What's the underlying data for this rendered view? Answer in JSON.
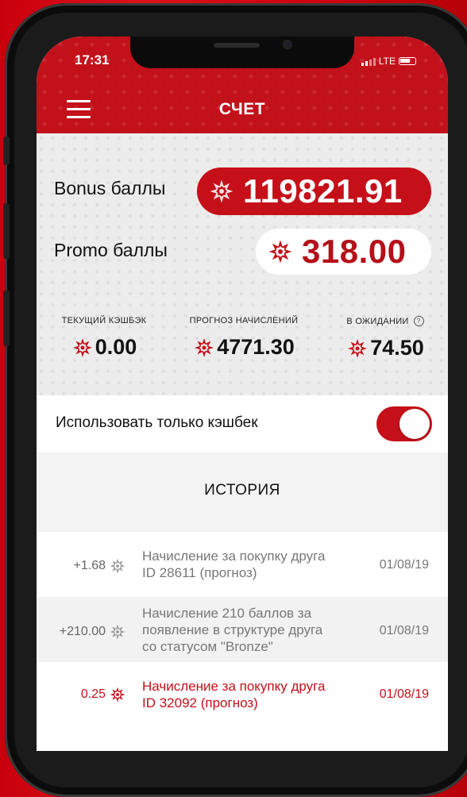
{
  "status": {
    "time": "17:31",
    "network": "LTE"
  },
  "header": {
    "title": "СЧЕТ"
  },
  "balances": {
    "bonus_label": "Bonus баллы",
    "bonus_value": "119821.91",
    "promo_label": "Promo баллы",
    "promo_value": "318.00"
  },
  "stats": [
    {
      "label": "ТЕКУЩИЙ КЭШБЭК",
      "value": "0.00"
    },
    {
      "label": "ПРОГНОЗ НАЧИСЛЕНИЙ",
      "value": "4771.30"
    },
    {
      "label": "В ОЖИДАНИИ",
      "value": "74.50"
    }
  ],
  "cashback_toggle": {
    "label": "Использовать только кэшбек",
    "enabled": true
  },
  "history": {
    "title": "ИСТОРИЯ",
    "items": [
      {
        "amount": "+1.68",
        "line1": "Начисление за покупку друга",
        "line2": "ID 28611 (прогноз)",
        "line3": "",
        "date": "01/08/19",
        "highlight": false
      },
      {
        "amount": "+210.00",
        "line1": "Начисление 210 баллов за",
        "line2": "появление в структуре друга",
        "line3": "со статусом \"Bronze\"",
        "date": "01/08/19",
        "highlight": false
      },
      {
        "amount": "0.25",
        "line1": "Начисление за покупку друга",
        "line2": "ID 32092 (прогноз)",
        "line3": "",
        "date": "01/08/19",
        "highlight": true
      }
    ]
  },
  "colors": {
    "brand_red": "#c51019",
    "panel_gray": "#ececec"
  },
  "icons": {
    "points": "snowflake-star-icon",
    "menu": "hamburger-icon",
    "info": "info-icon"
  }
}
